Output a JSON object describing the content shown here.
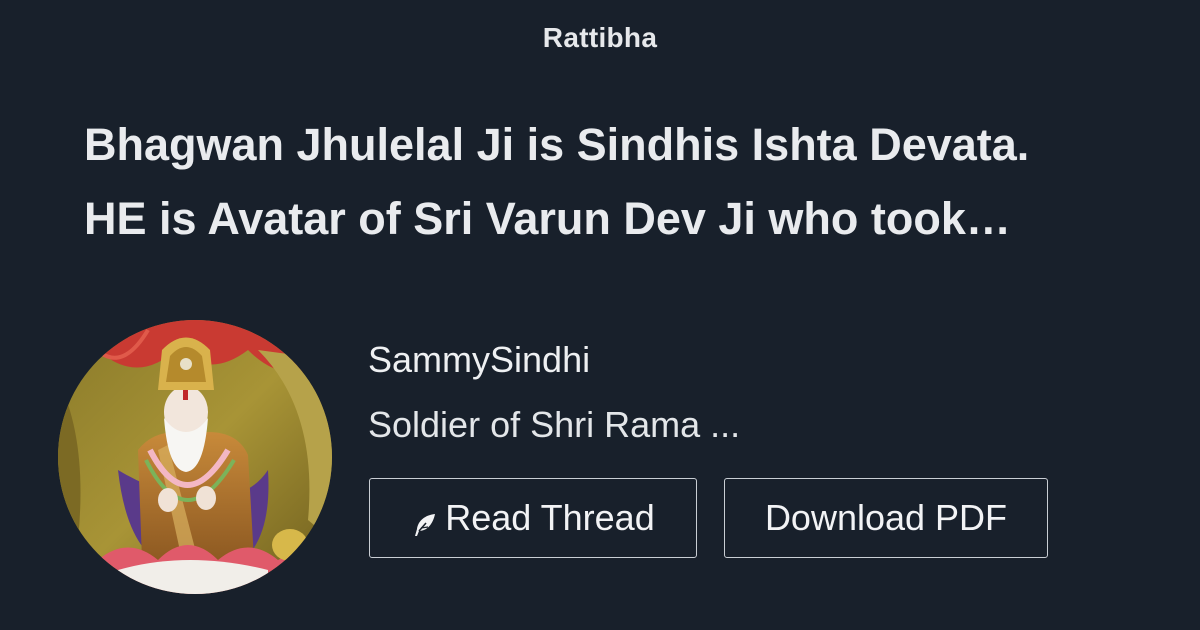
{
  "brand": {
    "name": "Rattibha"
  },
  "thread": {
    "title_line1": "Bhagwan Jhulelal Ji is Sindhis Ishta Devata.",
    "title_line2": "HE is Avatar of Sri Varun Dev Ji who took…"
  },
  "author": {
    "username": "SammySindhi",
    "bio": "Soldier of Shri Rama ..."
  },
  "actions": {
    "read_label": "Read Thread",
    "read_icon": "feather-icon",
    "pdf_label": "Download PDF"
  },
  "colors": {
    "background": "#18202b",
    "text": "#e9ecef",
    "button_border": "#c9ced4"
  }
}
